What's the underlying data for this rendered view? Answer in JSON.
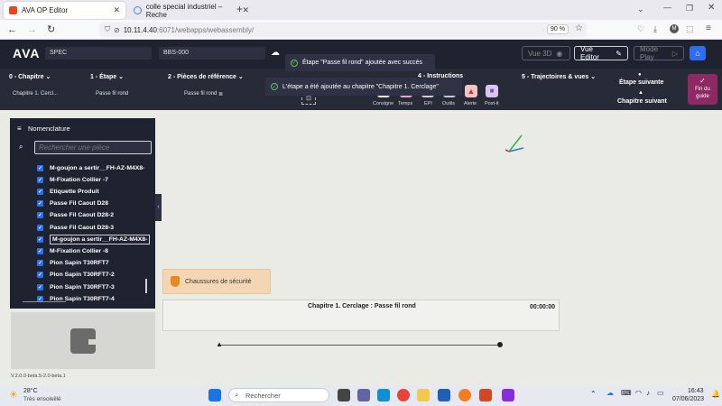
{
  "browser": {
    "tabs": [
      {
        "label": "AVA OP Editor",
        "active": true
      },
      {
        "label": "colle special industriel – Reche",
        "active": false
      }
    ],
    "new_tab": "+",
    "url_grey": "10.11.4.40",
    "url_rest": ":6071/webapps/webassembly/",
    "zoom": "90 %"
  },
  "app": {
    "logo": "AVA",
    "field1": "SPEC",
    "field2": "BBS-000",
    "btn_vue3d": "Vue 3D",
    "btn_vueeditor": "Vue Editor",
    "btn_modeplay": "Mode Play"
  },
  "toolbar": {
    "chapitre": "0 - Chapitre",
    "chapitre_sub": "Chapitre 1. Cercl...",
    "etape": "1 - Étape",
    "etape_sub": "Passe fil rond",
    "pieces": "2 - Pièces de référence",
    "pieces_sub": "Passe fil rond",
    "instructions": "4 - Instructions",
    "icons": [
      "Consigne",
      "Temps",
      "EPI",
      "Outils",
      "Alerte",
      "Post-it"
    ],
    "trajectoires": "5 - Trajectoires & vues",
    "etape_suivante": "Étape suivante",
    "chapitre_suivant": "Chapitre suivant",
    "fin_du_guide": "Fin du guide"
  },
  "toasts": {
    "t1": "Étape \"Passe fil rond\" ajoutée avec succès",
    "t2": "L'étape a été ajoutée au chapitre \"Chapitre 1. Cerclage\""
  },
  "panel": {
    "title": "Nomenclature",
    "search_placeholder": "Rechercher une pièce",
    "items": [
      "M-goujon a sertir__FH-AZ-M4X8-",
      "M-Fixation Collier -7",
      "Etiquette Produit",
      "Passe Fil Caout D28",
      "Passe Fil Caout D28-2",
      "Passe Fil Caout D28-3",
      "M-goujon a sertir__FH-AZ-M4X8-",
      "M-Fixation Collier -8",
      "Pion Sapin T30RFT7",
      "Pion Sapin T30RFT7-2",
      "Pion Sapin T30RFT7-3",
      "Pion Sapin T30RFT7-4"
    ],
    "selected_index": 6
  },
  "canvas": {
    "epi_label": "Chaussures de sécurité",
    "chapter_step": "Chapitre 1. Cerclage : Passe fil rond",
    "timer": "00:00:00"
  },
  "version": "V.2.0.0-beta.5-2.0-beta.1",
  "taskbar": {
    "weather_temp": "28°C",
    "weather_desc": "Très ensoleillé",
    "search_placeholder": "Rechercher",
    "time": "16:43",
    "date": "07/06/2023"
  },
  "colors": {
    "app_dark": "#1f2330",
    "accent_blue": "#2f6df0",
    "fin_guide": "#8e2a63"
  }
}
